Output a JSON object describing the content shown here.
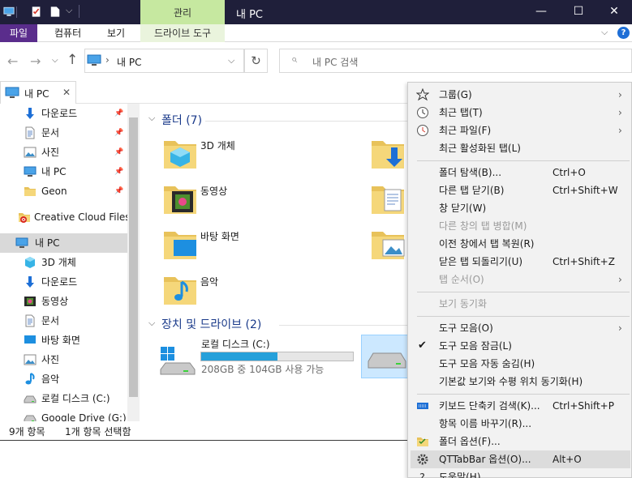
{
  "window": {
    "title": "내 PC",
    "manage_tab": "관리",
    "minimize": "—",
    "maximize": "☐",
    "close": "✕"
  },
  "ribbon": {
    "file": "파일",
    "computer": "컴퓨터",
    "view": "보기",
    "drive_tools": "드라이브 도구",
    "expand": "⌵",
    "help": "?"
  },
  "address": {
    "breadcrumb": "내 PC",
    "separator": "›",
    "dropdown": "⌵",
    "refresh": "↻",
    "search_placeholder": "내 PC 검색",
    "back": "←",
    "forward": "→",
    "recent": "⌵",
    "up": "↑"
  },
  "tab": {
    "label": "내 PC",
    "close": "✕"
  },
  "sidebar": {
    "items": [
      {
        "label": "다운로드",
        "icon": "download-arrow-icon",
        "pinned": true
      },
      {
        "label": "문서",
        "icon": "document-icon",
        "pinned": true
      },
      {
        "label": "사진",
        "icon": "pictures-icon",
        "pinned": true
      },
      {
        "label": "내 PC",
        "icon": "computer-icon",
        "pinned": true
      },
      {
        "label": "Geon",
        "icon": "folder-icon",
        "pinned": true
      },
      {
        "label": "Creative Cloud Files",
        "icon": "creative-cloud-icon",
        "pinned": false
      },
      {
        "label": "내 PC",
        "icon": "computer-icon",
        "pinned": false,
        "selected": true
      },
      {
        "label": "3D 개체",
        "icon": "3d-objects-icon",
        "pinned": false
      },
      {
        "label": "다운로드",
        "icon": "download-arrow-icon",
        "pinned": false
      },
      {
        "label": "동영상",
        "icon": "videos-icon",
        "pinned": false
      },
      {
        "label": "문서",
        "icon": "document-icon",
        "pinned": false
      },
      {
        "label": "바탕 화면",
        "icon": "desktop-icon",
        "pinned": false
      },
      {
        "label": "사진",
        "icon": "pictures-icon",
        "pinned": false
      },
      {
        "label": "음악",
        "icon": "music-icon",
        "pinned": false
      },
      {
        "label": "로컬 디스크 (C:)",
        "icon": "drive-icon",
        "pinned": false
      },
      {
        "label": "Google Drive (G:)",
        "icon": "drive-icon",
        "pinned": false
      }
    ],
    "pin_glyph": "📌"
  },
  "content": {
    "folders_header": "폴더 (7)",
    "folders": [
      {
        "label": "3D 개체",
        "icon": "3d-objects-folder-icon"
      },
      {
        "label": "동영상",
        "icon": "videos-folder-icon"
      },
      {
        "label": "바탕 화면",
        "icon": "desktop-folder-icon"
      },
      {
        "label": "음악",
        "icon": "music-folder-icon"
      }
    ],
    "drives_header": "장치 및 드라이브 (2)",
    "drive_c": {
      "label": "로컬 디스크 (C:)",
      "free_text": "208GB 중 104GB 사용 가능",
      "used_fraction": 0.5
    }
  },
  "status": {
    "count": "9개 항목",
    "selected": "1개 항목 선택함"
  },
  "context_menu": {
    "items": [
      {
        "label": "그룹(G)",
        "shortcut": "",
        "submenu": true,
        "icon": "star-icon"
      },
      {
        "label": "최근 탭(T)",
        "shortcut": "",
        "submenu": true,
        "icon": "clock-icon"
      },
      {
        "label": "최근 파일(F)",
        "shortcut": "",
        "submenu": true,
        "icon": "recent-file-icon"
      },
      {
        "label": "최근 활성화된 탭(L)",
        "shortcut": "",
        "submenu": false
      },
      {
        "sep": true
      },
      {
        "label": "폴더 탐색(B)...",
        "shortcut": "Ctrl+O",
        "submenu": false
      },
      {
        "label": "다른 탭 닫기(B)",
        "shortcut": "Ctrl+Shift+W",
        "submenu": false
      },
      {
        "label": "창 닫기(W)",
        "shortcut": "",
        "submenu": false
      },
      {
        "label": "다른 창의 탭 병합(M)",
        "shortcut": "",
        "submenu": false,
        "disabled": true
      },
      {
        "label": "이전 창에서 탭 복원(R)",
        "shortcut": "",
        "submenu": false
      },
      {
        "label": "닫은 탭 되돌리기(U)",
        "shortcut": "Ctrl+Shift+Z",
        "submenu": false
      },
      {
        "label": "탭 순서(O)",
        "shortcut": "",
        "submenu": true,
        "disabled": true
      },
      {
        "sep": true
      },
      {
        "label": "보기 동기화",
        "shortcut": "",
        "submenu": false,
        "disabled": true
      },
      {
        "sep": true
      },
      {
        "label": "도구 모음(O)",
        "shortcut": "",
        "submenu": true
      },
      {
        "label": "도구 모음 잠금(L)",
        "shortcut": "",
        "submenu": false,
        "checked": true
      },
      {
        "label": "도구 모음 자동 숨김(H)",
        "shortcut": "",
        "submenu": false
      },
      {
        "label": "기본값 보기와 수평 위치 동기화(H)",
        "shortcut": "",
        "submenu": false
      },
      {
        "sep": true
      },
      {
        "label": "키보드 단축키 검색(K)...",
        "shortcut": "Ctrl+Shift+P",
        "submenu": false,
        "icon": "keyboard-icon"
      },
      {
        "label": "항목 이름 바꾸기(R)...",
        "shortcut": "",
        "submenu": false
      },
      {
        "label": "폴더 옵션(F)...",
        "shortcut": "",
        "submenu": false,
        "icon": "folder-options-icon"
      },
      {
        "label": "QTTabBar 옵션(O)...",
        "shortcut": "Alt+O",
        "submenu": false,
        "icon": "gear-icon",
        "highlighted": true
      },
      {
        "label": "도움말(H)",
        "shortcut": "",
        "submenu": false,
        "icon": "help-icon"
      }
    ],
    "arrow_glyph": "›",
    "check_glyph": "✔"
  },
  "colors": {
    "titlebar": "#1f1f3a",
    "file_tab": "#5a2d8c",
    "manage_tab": "#c6e8a0",
    "drive_fill": "#26a0da",
    "selection": "#cce8ff",
    "group_header": "#1a3a8a"
  }
}
